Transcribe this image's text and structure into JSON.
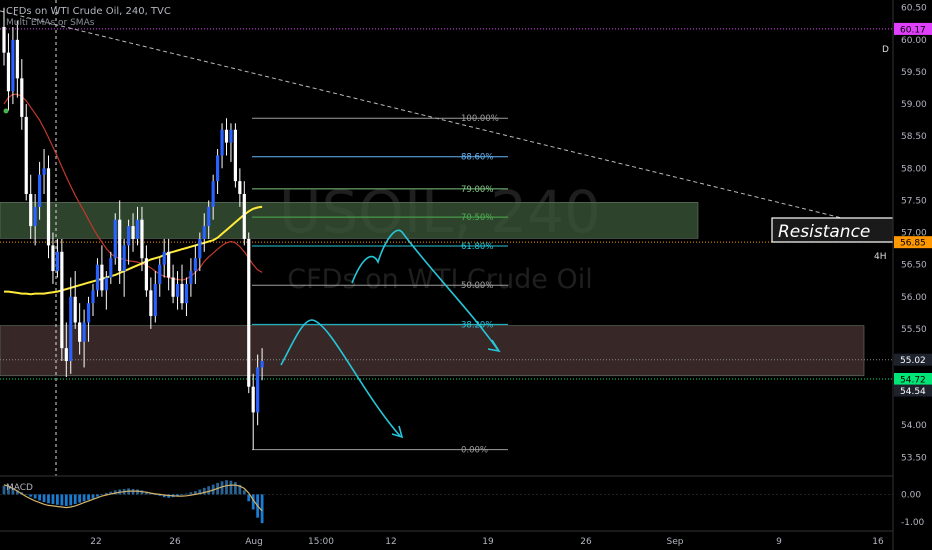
{
  "header": {
    "symbol_line": "CFDs on WTI Crude Oil, 240, TVC",
    "indicator": "Multi EMAs or SMAs"
  },
  "watermark": {
    "symbol": "USOIL, 240",
    "name": "CFDs on WTI Crude Oil"
  },
  "labels": {
    "resistance": "Resistance",
    "tf_daily": "D",
    "tf_4h": "4H",
    "macd": "MACD"
  },
  "colors": {
    "bg": "#000000",
    "candle": "#2962ff",
    "wick": "#ffffff",
    "ema_fast": "#ffeb3b",
    "ema_slow": "#c0392b",
    "fib": "#9e9e9e",
    "arrow": "#26c6da",
    "resistance_zone": "#3a5a40",
    "support_zone": "#5a3a3a",
    "last_price": "#00e676",
    "level_magenta": "#e040fb",
    "level_orange": "#ff9800"
  },
  "chart_data": {
    "type": "candlestick",
    "title": "CFDs on WTI Crude Oil, 240, TVC",
    "x_ticks": [
      "22",
      "26",
      "Aug",
      "15:00",
      "12",
      "19",
      "26",
      "Sep",
      "9",
      "16"
    ],
    "y_ticks": [
      "60.50",
      "60.00",
      "59.50",
      "59.00",
      "58.50",
      "58.00",
      "57.50",
      "57.00",
      "56.50",
      "56.00",
      "55.50",
      "55.00",
      "54.50",
      "54.00",
      "53.50"
    ],
    "ylim": [
      53.35,
      60.62
    ],
    "price_labels": [
      {
        "value": 60.17,
        "text": "60.17",
        "color": "#e040fb"
      },
      {
        "value": 56.85,
        "text": "56.85",
        "color": "#ff9800"
      },
      {
        "value": 55.02,
        "text": "55.02",
        "color": "#1e222d"
      },
      {
        "value": 54.72,
        "text": "54.72",
        "color": "#00e676"
      },
      {
        "value": 54.54,
        "text": "54.54",
        "color": "#1e222d"
      }
    ],
    "fib_levels": [
      {
        "ratio": "100.00%",
        "price": 58.78,
        "color": "#9e9e9e"
      },
      {
        "ratio": "88.60%",
        "price": 58.18,
        "color": "#64b5f6"
      },
      {
        "ratio": "79.00%",
        "price": 57.68,
        "color": "#81c784"
      },
      {
        "ratio": "70.50%",
        "price": 57.24,
        "color": "#4caf50"
      },
      {
        "ratio": "61.80%",
        "price": 56.79,
        "color": "#26c6da"
      },
      {
        "ratio": "50.00%",
        "price": 56.18,
        "color": "#9e9e9e"
      },
      {
        "ratio": "38.20%",
        "price": 55.57,
        "color": "#26c6da"
      },
      {
        "ratio": "0.00%",
        "price": 53.62,
        "color": "#9e9e9e"
      }
    ],
    "zones": [
      {
        "name": "resistance",
        "from": 56.91,
        "to": 57.47
      },
      {
        "name": "support",
        "from": 54.77,
        "to": 55.55
      }
    ],
    "ohlc": [
      [
        60.2,
        60.5,
        59.6,
        59.8
      ],
      [
        59.8,
        60.1,
        58.9,
        59.2
      ],
      [
        59.2,
        60.2,
        59.0,
        60.0
      ],
      [
        60.0,
        60.3,
        59.1,
        59.4
      ],
      [
        59.4,
        59.7,
        58.6,
        58.8
      ],
      [
        58.8,
        59.0,
        57.5,
        57.6
      ],
      [
        57.6,
        57.9,
        56.9,
        57.1
      ],
      [
        57.1,
        57.6,
        56.8,
        57.4
      ],
      [
        57.4,
        58.1,
        57.2,
        57.9
      ],
      [
        57.9,
        58.3,
        57.6,
        58.0
      ],
      [
        58.0,
        58.2,
        56.6,
        56.8
      ],
      [
        56.8,
        57.0,
        56.2,
        56.4
      ],
      [
        56.4,
        56.9,
        56.3,
        56.7
      ],
      [
        56.7,
        56.9,
        55.0,
        55.2
      ],
      [
        55.2,
        55.6,
        54.75,
        55.0
      ],
      [
        55.0,
        56.3,
        54.8,
        56.0
      ],
      [
        56.0,
        56.4,
        55.5,
        55.6
      ],
      [
        55.6,
        55.9,
        55.1,
        55.3
      ],
      [
        55.3,
        55.8,
        54.9,
        55.6
      ],
      [
        55.6,
        56.0,
        55.3,
        55.9
      ],
      [
        55.9,
        56.2,
        55.7,
        56.1
      ],
      [
        56.1,
        56.6,
        56.0,
        56.5
      ],
      [
        56.5,
        56.8,
        56.0,
        56.1
      ],
      [
        56.1,
        56.4,
        55.8,
        56.3
      ],
      [
        56.3,
        56.7,
        56.2,
        56.6
      ],
      [
        56.6,
        57.3,
        56.5,
        57.2
      ],
      [
        57.2,
        57.5,
        56.2,
        56.4
      ],
      [
        56.4,
        56.9,
        56.0,
        56.8
      ],
      [
        56.8,
        57.2,
        56.5,
        57.1
      ],
      [
        57.1,
        57.3,
        56.7,
        56.9
      ],
      [
        56.9,
        57.4,
        56.8,
        57.2
      ],
      [
        57.2,
        57.4,
        56.4,
        56.6
      ],
      [
        56.6,
        56.8,
        56.0,
        56.1
      ],
      [
        56.1,
        56.3,
        55.5,
        55.7
      ],
      [
        55.7,
        56.4,
        55.6,
        56.2
      ],
      [
        56.2,
        56.6,
        56.0,
        56.5
      ],
      [
        56.5,
        56.9,
        56.3,
        56.7
      ],
      [
        56.7,
        56.9,
        56.1,
        56.3
      ],
      [
        56.3,
        56.5,
        55.9,
        56.0
      ],
      [
        56.0,
        56.4,
        55.8,
        56.2
      ],
      [
        56.2,
        56.5,
        55.8,
        55.9
      ],
      [
        55.9,
        56.3,
        55.7,
        56.2
      ],
      [
        56.2,
        56.6,
        56.0,
        56.4
      ],
      [
        56.4,
        56.8,
        56.2,
        56.6
      ],
      [
        56.6,
        57.0,
        56.4,
        56.9
      ],
      [
        56.9,
        57.3,
        56.7,
        57.1
      ],
      [
        57.1,
        57.5,
        56.9,
        57.4
      ],
      [
        57.4,
        57.9,
        57.2,
        57.8
      ],
      [
        57.8,
        58.3,
        57.6,
        58.2
      ],
      [
        58.2,
        58.7,
        58.0,
        58.6
      ],
      [
        58.6,
        58.78,
        58.2,
        58.4
      ],
      [
        58.4,
        58.7,
        58.1,
        58.6
      ],
      [
        58.6,
        58.7,
        57.7,
        57.8
      ],
      [
        57.8,
        58.0,
        57.4,
        57.6
      ],
      [
        57.6,
        57.8,
        56.8,
        56.9
      ],
      [
        56.9,
        57.0,
        54.5,
        54.6
      ],
      [
        54.6,
        54.8,
        53.62,
        54.2
      ],
      [
        54.2,
        55.1,
        54.0,
        54.9
      ],
      [
        54.9,
        55.2,
        54.7,
        55.0
      ]
    ],
    "ema_fast": [
      56.08,
      56.08,
      56.07,
      56.06,
      56.05,
      56.05,
      56.04,
      56.05,
      56.05,
      56.05,
      56.06,
      56.07,
      56.08,
      56.1,
      56.12,
      56.14,
      56.16,
      56.18,
      56.2,
      56.22,
      56.24,
      56.26,
      56.28,
      56.3,
      56.32,
      56.34,
      56.37,
      56.4,
      56.43,
      56.46,
      56.49,
      56.52,
      56.55,
      56.58,
      56.6,
      56.62,
      56.65,
      56.68,
      56.7,
      56.72,
      56.74,
      56.76,
      56.78,
      56.8,
      56.82,
      56.84,
      56.86,
      56.88,
      56.92,
      56.98,
      57.04,
      57.1,
      57.16,
      57.22,
      57.28,
      57.33,
      57.37,
      57.39,
      57.4
    ],
    "ema_slow": [
      59.0,
      59.1,
      59.15,
      59.15,
      59.12,
      59.05,
      58.95,
      58.85,
      58.75,
      58.62,
      58.48,
      58.33,
      58.18,
      58.02,
      57.87,
      57.72,
      57.58,
      57.45,
      57.33,
      57.2,
      57.07,
      56.95,
      56.85,
      56.75,
      56.67,
      56.62,
      56.6,
      56.58,
      56.56,
      56.55,
      56.54,
      56.52,
      56.49,
      56.45,
      56.4,
      56.35,
      56.32,
      56.3,
      56.28,
      56.27,
      56.26,
      56.28,
      56.32,
      56.38,
      56.45,
      56.55,
      56.62,
      56.68,
      56.74,
      56.8,
      56.84,
      56.86,
      56.84,
      56.78,
      56.7,
      56.6,
      56.5,
      56.42,
      56.38
    ],
    "macd_hist": [
      0.32,
      0.28,
      0.22,
      0.15,
      0.08,
      0.0,
      -0.08,
      -0.15,
      -0.22,
      -0.28,
      -0.32,
      -0.35,
      -0.38,
      -0.4,
      -0.42,
      -0.4,
      -0.35,
      -0.3,
      -0.25,
      -0.2,
      -0.15,
      -0.08,
      0.0,
      0.05,
      0.1,
      0.15,
      0.18,
      0.2,
      0.22,
      0.2,
      0.18,
      0.15,
      0.1,
      0.05,
      0.0,
      -0.05,
      -0.1,
      -0.12,
      -0.1,
      -0.06,
      -0.02,
      0.03,
      0.08,
      0.12,
      0.18,
      0.24,
      0.3,
      0.36,
      0.42,
      0.48,
      0.52,
      0.5,
      0.45,
      0.35,
      0.15,
      -0.25,
      -0.55,
      -0.85,
      -1.05
    ],
    "macd_line": [
      0.35,
      0.3,
      0.22,
      0.12,
      0.02,
      -0.08,
      -0.16,
      -0.24,
      -0.3,
      -0.36,
      -0.4,
      -0.42,
      -0.44,
      -0.46,
      -0.48,
      -0.46,
      -0.42,
      -0.36,
      -0.3,
      -0.24,
      -0.18,
      -0.12,
      -0.06,
      -0.02,
      0.02,
      0.05,
      0.08,
      0.1,
      0.12,
      0.12,
      0.12,
      0.1,
      0.08,
      0.05,
      0.02,
      0.0,
      -0.02,
      -0.04,
      -0.05,
      -0.06,
      -0.06,
      -0.05,
      -0.03,
      0.0,
      0.03,
      0.07,
      0.11,
      0.16,
      0.22,
      0.28,
      0.32,
      0.34,
      0.34,
      0.3,
      0.22,
      0.05,
      -0.2,
      -0.42,
      -0.6
    ],
    "macd_ylim": [
      -1.3,
      0.6
    ],
    "macd_ticks": [
      "0.00",
      "-1.00"
    ]
  }
}
